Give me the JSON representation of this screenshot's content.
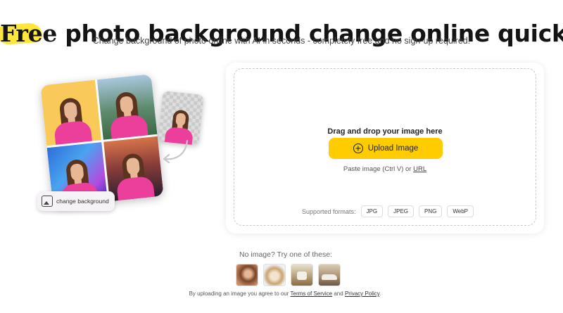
{
  "header": {
    "title_highlight": "Free",
    "title_rest": " photo background change online quickly",
    "subtitle": "Change background of photo online with AI in seconds - completely free and no sign-up required!"
  },
  "illustration": {
    "pill_label": "change background"
  },
  "upload": {
    "drop_text": "Drag and drop your image here",
    "button_label": "Upload Image",
    "paste_text": "Paste image (Ctrl V) or",
    "url_label": "URL",
    "formats_label": "Supported formats:",
    "formats": [
      "JPG",
      "JPEG",
      "PNG",
      "WebP"
    ]
  },
  "samples": {
    "label": "No image? Try one of these:"
  },
  "legal": {
    "prefix": "By uploading an image you agree to our",
    "terms_label": "Terms of Service",
    "and": "and",
    "privacy_label": "Privacy Policy",
    "suffix": "."
  }
}
